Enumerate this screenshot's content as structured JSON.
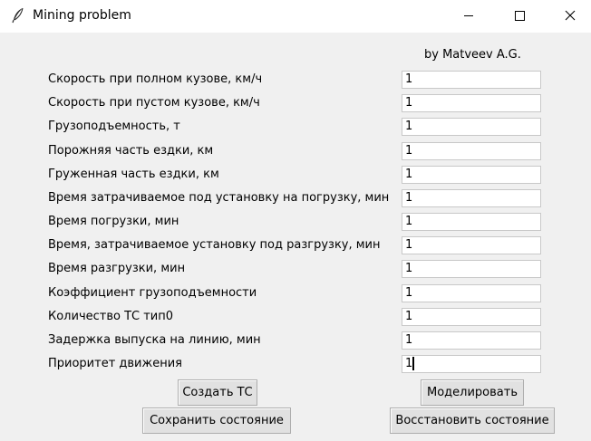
{
  "window": {
    "title": "Mining problem",
    "icon": "feather-icon"
  },
  "author": "by Matveev A.G.",
  "fields": [
    {
      "label": "Скорость при полном кузове, км/ч",
      "value": "1"
    },
    {
      "label": "Скорость при пустом кузове, км/ч",
      "value": "1"
    },
    {
      "label": "Грузоподъемность, т",
      "value": "1"
    },
    {
      "label": "Порожняя часть ездки, км",
      "value": "1"
    },
    {
      "label": "Груженная часть ездки, км",
      "value": "1"
    },
    {
      "label": "Время затрачиваемое под установку на погрузку, мин",
      "value": "1"
    },
    {
      "label": "Время погрузки, мин",
      "value": "1"
    },
    {
      "label": "Время, затрачиваемое установку под разгрузку, мин",
      "value": "1"
    },
    {
      "label": "Время разгрузки, мин",
      "value": "1"
    },
    {
      "label": "Коэффициент грузоподъемности",
      "value": "1"
    },
    {
      "label": "Количество ТС тип0",
      "value": "1"
    },
    {
      "label": "Задержка выпуска на линию, мин",
      "value": "1"
    },
    {
      "label": "Приоритет движения",
      "value": "1"
    }
  ],
  "buttons": {
    "create": "Создать ТС",
    "simulate": "Моделировать",
    "save": "Сохранить состояние",
    "restore": "Восстановить состояние"
  }
}
